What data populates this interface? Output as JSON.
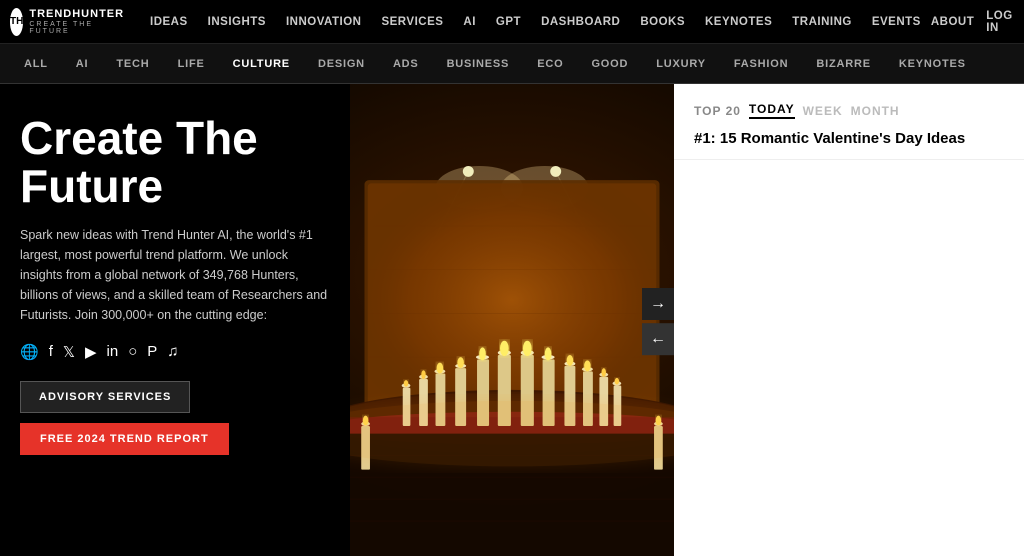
{
  "logo": {
    "icon": "TH",
    "name": "TRENDHUNTER",
    "tagline": "CREATE THE FUTURE"
  },
  "main_nav": {
    "items": [
      {
        "label": "IDEAS",
        "href": "#"
      },
      {
        "label": "INSIGHTS",
        "href": "#"
      },
      {
        "label": "INNOVATION",
        "href": "#"
      },
      {
        "label": "SERVICES",
        "href": "#"
      },
      {
        "label": "AI",
        "href": "#"
      },
      {
        "label": "GPT",
        "href": "#"
      },
      {
        "label": "DASHBOARD",
        "href": "#"
      },
      {
        "label": "BOOKS",
        "href": "#"
      },
      {
        "label": "KEYNOTES",
        "href": "#"
      },
      {
        "label": "TRAINING",
        "href": "#"
      },
      {
        "label": "EVENTS",
        "href": "#"
      }
    ],
    "right": [
      {
        "label": "ABOUT",
        "href": "#"
      },
      {
        "label": "LOG IN",
        "href": "#"
      }
    ]
  },
  "categories": {
    "items": [
      {
        "label": "ALL",
        "active": false
      },
      {
        "label": "AI",
        "active": false
      },
      {
        "label": "TECH",
        "active": false
      },
      {
        "label": "LIFE",
        "active": false
      },
      {
        "label": "CULTURE",
        "active": true
      },
      {
        "label": "DESIGN",
        "active": false
      },
      {
        "label": "ADS",
        "active": false
      },
      {
        "label": "BUSINESS",
        "active": false
      },
      {
        "label": "ECO",
        "active": false
      },
      {
        "label": "GOOD",
        "active": false
      },
      {
        "label": "LUXURY",
        "active": false
      },
      {
        "label": "FASHION",
        "active": false
      },
      {
        "label": "BIZARRE",
        "active": false
      },
      {
        "label": "KEYNOTES",
        "active": false
      }
    ]
  },
  "hero": {
    "title": "Create The Future",
    "description": "Spark new ideas with Trend Hunter AI, the world's #1 largest, most powerful trend platform. We unlock insights from a global network of 349,768 Hunters, billions of views, and a skilled team of Researchers and Futurists. Join 300,000+ on the cutting edge:",
    "btn_advisory": "ADVISORY SERVICES",
    "btn_trend": "FREE 2024 TREND REPORT"
  },
  "social": {
    "icons": [
      "f",
      "𝕏",
      "▶",
      "in",
      "◎",
      "𝑃",
      "♪"
    ]
  },
  "right_panel": {
    "label": "TOP 20",
    "periods": [
      "TODAY",
      "WEEK",
      "MONTH"
    ],
    "active_period": "TODAY",
    "top_item": "#1: 15 Romantic Valentine's Day Ideas"
  },
  "arrows": {
    "right": "→",
    "left": "←"
  }
}
